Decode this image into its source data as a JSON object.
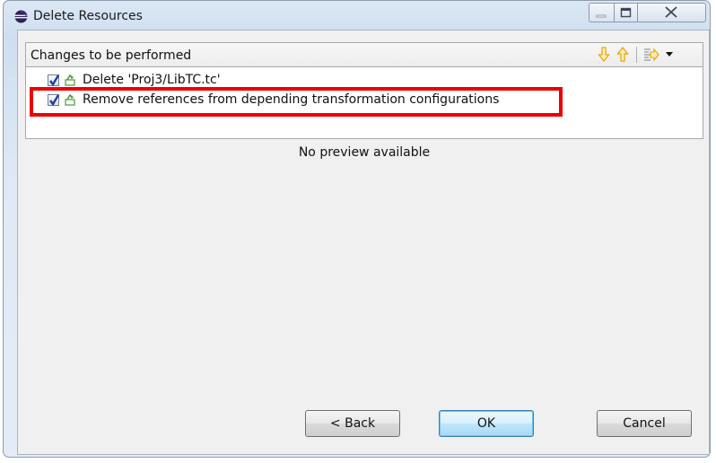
{
  "window": {
    "title": "Delete Resources",
    "icon": "eclipse-icon"
  },
  "section": {
    "title": "Changes to be performed",
    "toolbar_icons": [
      "arrow-down-icon",
      "arrow-up-icon",
      "layout-icon",
      "dropdown-caret-icon"
    ]
  },
  "changes": [
    {
      "label": "Delete 'Proj3/LibTC.tc'",
      "checked": true,
      "icon": "change-icon"
    },
    {
      "label": "Remove references from depending transformation configurations",
      "checked": true,
      "icon": "change-icon",
      "highlighted": true
    }
  ],
  "preview": {
    "message": "No preview available"
  },
  "buttons": {
    "back": "< Back",
    "ok": "OK",
    "cancel": "Cancel"
  },
  "colors": {
    "highlight": "#ee0000",
    "arrow": "#f0a800"
  }
}
